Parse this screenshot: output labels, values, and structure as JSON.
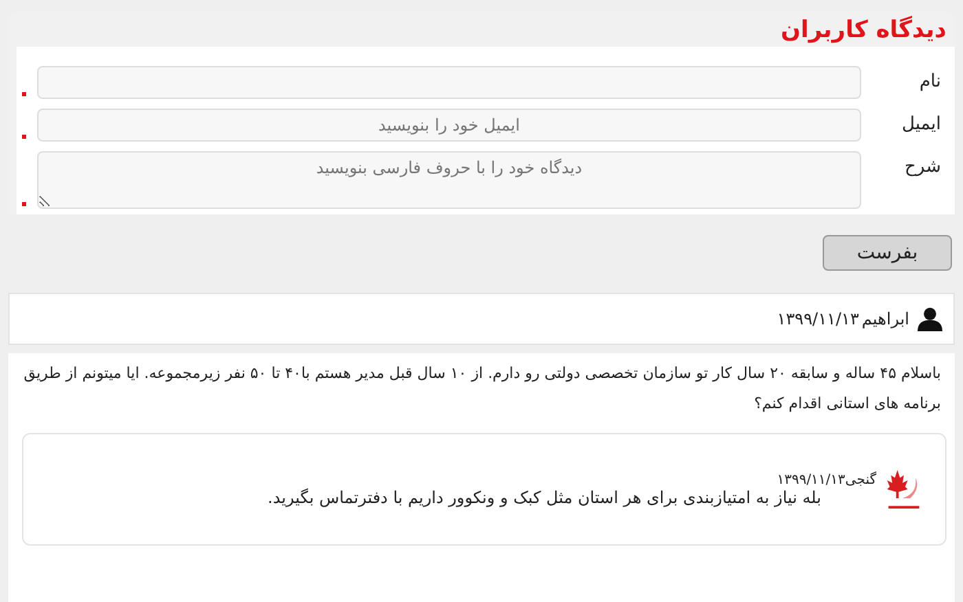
{
  "title": "دیدگاه کاربران",
  "fields": [
    {
      "kind": "input",
      "label": "نام",
      "required": true
    },
    {
      "kind": "input",
      "label": "ایمیل",
      "placeholder": "ایمیل خود را بنویسید",
      "required": true
    },
    {
      "kind": "textarea",
      "label": "شرح",
      "placeholder": "دیدگاه خود را با حروف فارسی بنویسید",
      "required": true
    }
  ],
  "submit": "بفرست",
  "comment": {
    "author": "ابراهیم",
    "date": "۱۳۹۹/۱۱/۱۳",
    "text": "باسلام ۴۵ ساله و سابقه ۲۰ سال کار تو سازمان تخصصی دولتی رو دارم. از ۱۰ سال قبل مدیر هستم با۴۰ تا ۵۰ نفر زیرمجموعه. ایا میتونم از طریق برنامه های استانی اقدام کنم؟"
  },
  "reply": {
    "author": "گنجی",
    "date": "۱۳۹۹/۱۱/۱۳",
    "text": "بله نیاز به امتیازبندی برای هر استان مثل کبک و ونکوور داریم با دفترتماس بگیرید."
  }
}
